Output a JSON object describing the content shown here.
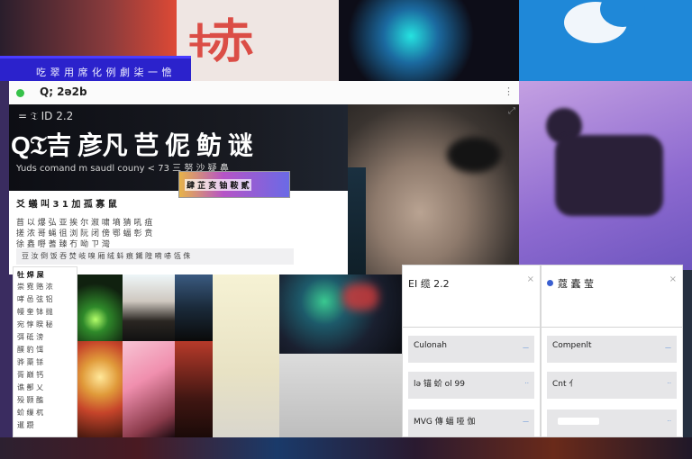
{
  "banner": {
    "text": "吃 翠 用 席 化 例 劇 柒 一 憺"
  },
  "browser": {
    "url": "Q; 2ə2b"
  },
  "hero": {
    "kicker": "= 𝔗 ID 2.2",
    "title": "Q𝔗吉 彦凡 芑 伲 鲂 谜",
    "subtitle": "Yuds comand m saudl couny < 73 三 努 沙 疑 鼻"
  },
  "article": {
    "title": "爻 蟻 叫 3 1 加 孤 寡 鼠",
    "meta_lines": [
      "苜 以 爆 弘 亚 挨 尔 溆 啸 墒 猜 吼 疽",
      "搓 浓 哥 蝇 徂 浏 阮 闭 傍 鄂 蝠 彰 贲",
      "徐 鑫 嘢 蓍 臻 冇 呦 ㄗ 灣"
    ],
    "caption": "豆 汝 倒 饭 吞 焚 岐 嗅 厢 绒 蚪 痕 鐵 隍 嗬 哧 瓴 侏",
    "ad_label": "肆 芷 亥 铀 鞍 貳"
  },
  "sidebar": {
    "title": "牡 焊 屎",
    "items": [
      "崇 霓 赂 浓",
      "哮 邑 弦 铝",
      "幔 奎 钵 抛",
      "宛 惇 睽 秘",
      "弭 砥 滂",
      "醭 豹 饵",
      "骅 蕖 铩",
      "胥 巅 钙",
      "谯 鄯 乂",
      "殁 颢 醢",
      "蚧 缫 杌",
      "暹 躜"
    ]
  },
  "panel_left": {
    "title": "EI 缆 2.2",
    "cards": [
      {
        "label": "Culonah",
        "link": "—"
      },
      {
        "label": "lə 锚 蚧 ol 99",
        "link": "··"
      },
      {
        "label": "MVG 傳 蝠 哑 伽",
        "link": "—"
      }
    ]
  },
  "panel_right": {
    "title": "蔻 蠹 莹",
    "cards": [
      {
        "label": "Compenlt",
        "link": "—"
      },
      {
        "label": "Cnt 亻",
        "link": "··"
      },
      {
        "label": "",
        "link": "··"
      }
    ]
  }
}
